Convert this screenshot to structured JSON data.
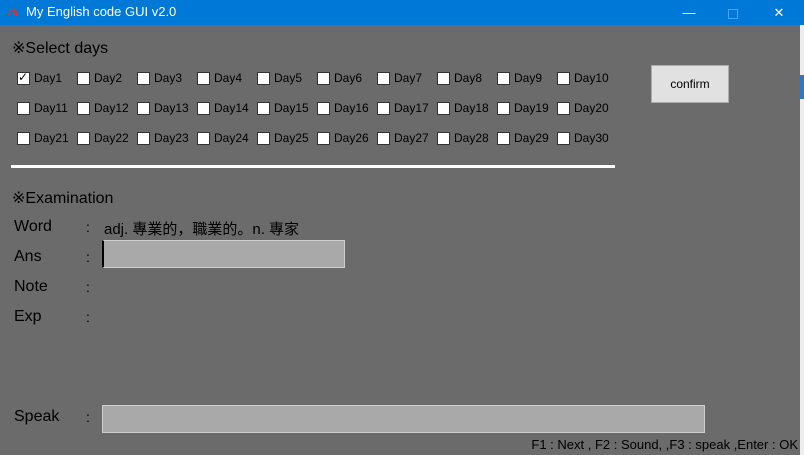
{
  "window": {
    "title": "My English code GUI v2.0",
    "min_glyph": "—",
    "max_glyph": "☐",
    "close_glyph": "✕"
  },
  "select_days": {
    "title": "※Select days",
    "days": [
      {
        "label": "Day1",
        "checked": true
      },
      {
        "label": "Day2",
        "checked": false
      },
      {
        "label": "Day3",
        "checked": false
      },
      {
        "label": "Day4",
        "checked": false
      },
      {
        "label": "Day5",
        "checked": false
      },
      {
        "label": "Day6",
        "checked": false
      },
      {
        "label": "Day7",
        "checked": false
      },
      {
        "label": "Day8",
        "checked": false
      },
      {
        "label": "Day9",
        "checked": false
      },
      {
        "label": "Day10",
        "checked": false
      },
      {
        "label": "Day11",
        "checked": false
      },
      {
        "label": "Day12",
        "checked": false
      },
      {
        "label": "Day13",
        "checked": false
      },
      {
        "label": "Day14",
        "checked": false
      },
      {
        "label": "Day15",
        "checked": false
      },
      {
        "label": "Day16",
        "checked": false
      },
      {
        "label": "Day17",
        "checked": false
      },
      {
        "label": "Day18",
        "checked": false
      },
      {
        "label": "Day19",
        "checked": false
      },
      {
        "label": "Day20",
        "checked": false
      },
      {
        "label": "Day21",
        "checked": false
      },
      {
        "label": "Day22",
        "checked": false
      },
      {
        "label": "Day23",
        "checked": false
      },
      {
        "label": "Day24",
        "checked": false
      },
      {
        "label": "Day25",
        "checked": false
      },
      {
        "label": "Day26",
        "checked": false
      },
      {
        "label": "Day27",
        "checked": false
      },
      {
        "label": "Day28",
        "checked": false
      },
      {
        "label": "Day29",
        "checked": false
      },
      {
        "label": "Day30",
        "checked": false
      }
    ],
    "confirm_label": "confirm"
  },
  "examination": {
    "title": "※Examination",
    "word_label": "Word",
    "word_value": "adj. 專業的，職業的。n. 專家",
    "ans_label": "Ans",
    "ans_value": "",
    "note_label": "Note",
    "exp_label": "Exp",
    "speak_label": "Speak",
    "speak_value": "",
    "colon": ":"
  },
  "hint": "F1 : Next , F2 : Sound, ,F3 : speak ,Enter : OK",
  "colors": {
    "background": "#6b6b6b",
    "titlebar": "#0078d7",
    "input_bg": "#a9a9a9"
  }
}
